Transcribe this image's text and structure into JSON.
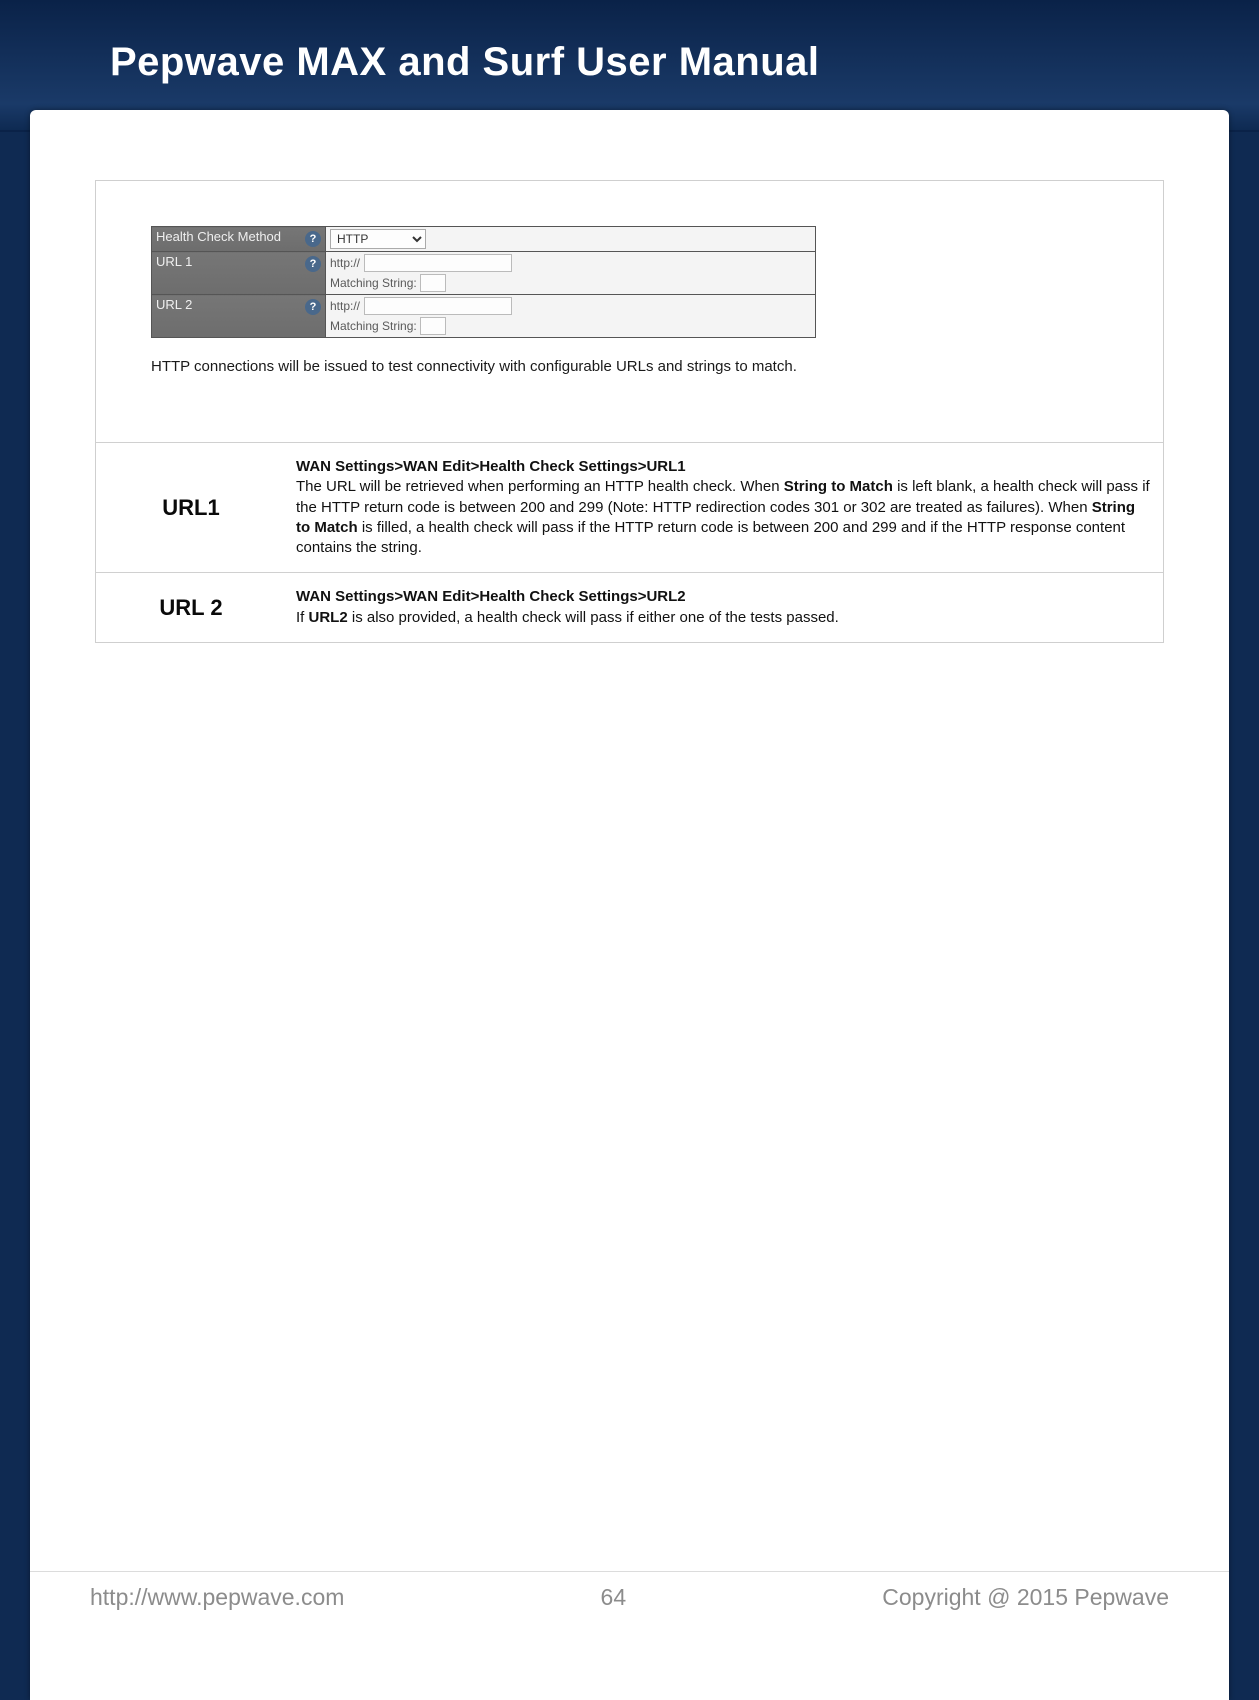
{
  "header": {
    "title": "Pepwave MAX and Surf User Manual"
  },
  "config_panel": {
    "rows": [
      {
        "label": "Health Check Method",
        "type": "select",
        "value": "HTTP"
      },
      {
        "label": "URL 1",
        "type": "url",
        "prefix": "http://",
        "value": "",
        "matching_label": "Matching String:",
        "matching_value": ""
      },
      {
        "label": "URL 2",
        "type": "url",
        "prefix": "http://",
        "value": "",
        "matching_label": "Matching String:",
        "matching_value": ""
      }
    ]
  },
  "caption": "HTTP connections will be issued to test connectivity with configurable URLs and strings to match.",
  "definitions": [
    {
      "term": "URL1",
      "breadcrumb": "WAN Settings>WAN Edit>Health Check Settings>URL1",
      "body_pre1": "The URL will be retrieved when performing an HTTP health check. When ",
      "bold1": "String to Match",
      "body_mid1": " is left blank, a health check will pass if the HTTP return code is between 200 and 299 (Note: HTTP redirection codes 301 or 302 are treated as failures). When ",
      "bold2": "String to Match",
      "body_post1": " is filled, a health check will pass if the HTTP return code is between 200 and 299 and if the HTTP response content contains the string."
    },
    {
      "term": "URL 2",
      "breadcrumb": "WAN Settings>WAN Edit>Health Check Settings>URL2",
      "body_pre1": "If ",
      "bold1": "URL2",
      "body_mid1": " is also provided, a health check will pass if either one of the tests passed.",
      "bold2": "",
      "body_post1": ""
    }
  ],
  "footer": {
    "left": "http://www.pepwave.com",
    "center": "64",
    "right": "Copyright @ 2015 Pepwave"
  }
}
